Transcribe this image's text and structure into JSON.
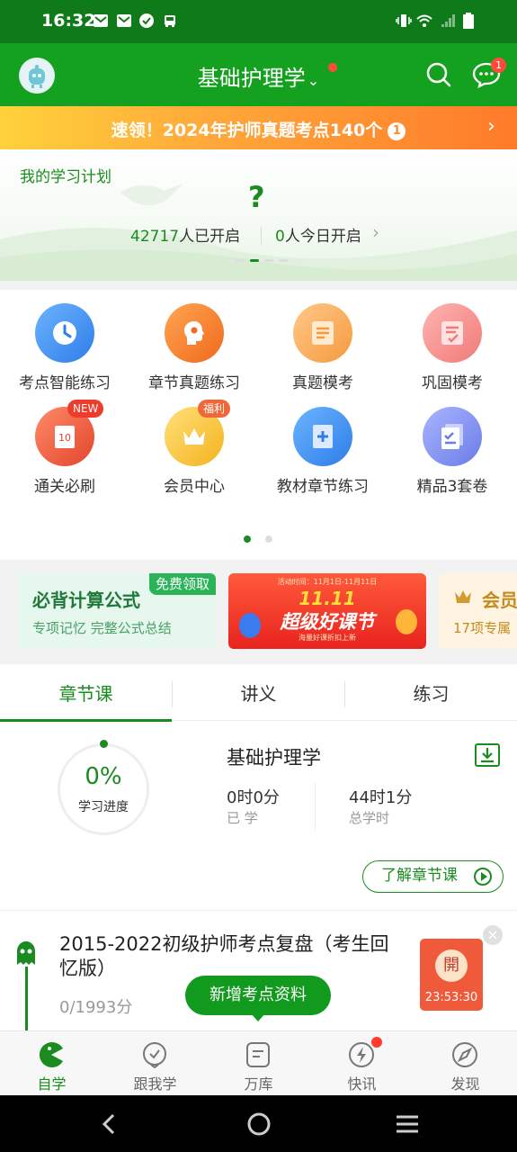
{
  "status_bar": {
    "time": "16:32"
  },
  "header": {
    "title": "基础护理学",
    "title_chevron": "⌄",
    "message_badge": "1"
  },
  "promo": {
    "text": "速领！2024年护师真题考点140个",
    "number": "1",
    "arrow": "›"
  },
  "plan": {
    "label": "我的学习计划",
    "status_symbol": "?",
    "started_count": "42717",
    "started_suffix": "人已开启",
    "today_count": "0",
    "today_suffix": "人今日开启",
    "arrow": "›"
  },
  "grid": [
    {
      "label": "考点智能练习",
      "color": "#3d8ef0"
    },
    {
      "label": "章节真题练习",
      "color": "#f5842e"
    },
    {
      "label": "真题模考",
      "color": "#f7a858"
    },
    {
      "label": "巩固模考",
      "color": "#f48a88"
    },
    {
      "label": "通关必刷",
      "color": "#ee5a3e",
      "tag": "NEW"
    },
    {
      "label": "会员中心",
      "color": "#f6c13d",
      "tag": "福利"
    },
    {
      "label": "教材章节练习",
      "color": "#3d8ef0"
    },
    {
      "label": "精品3套卷",
      "color": "#7c8ef0"
    }
  ],
  "ads": {
    "card1": {
      "title": "必背计算公式",
      "subtitle": "专项记忆 完整公式总结",
      "tag": "免费领取"
    },
    "card2": {
      "big": "11.11",
      "title": "超级好课节",
      "date": "活动时间：11月1日-11月11日",
      "sub": "海量好课折扣上新"
    },
    "card3": {
      "title": "会员",
      "subtitle": "17项专属"
    }
  },
  "tabs": [
    "章节课",
    "讲义",
    "练习"
  ],
  "progress": {
    "percent": "0%",
    "percent_label": "学习进度",
    "course_name": "基础护理学",
    "learned_value": "0时0分",
    "learned_label": "已 学",
    "total_value": "44时1分",
    "total_label": "总学时",
    "button": "了解章节课"
  },
  "item": {
    "title": "2015-2022初级护师考点复盘（考生回忆版）",
    "score": "0/1993分",
    "red_packet_char": "開",
    "countdown": "23:53:30",
    "close": "×"
  },
  "toast": "新增考点资料",
  "bottom_nav": [
    "自学",
    "跟我学",
    "万库",
    "快讯",
    "发现"
  ],
  "colors": {
    "brand_green": "#14a11f",
    "dark_green": "#0f7a1a",
    "accent_red": "#ff4b3a"
  }
}
